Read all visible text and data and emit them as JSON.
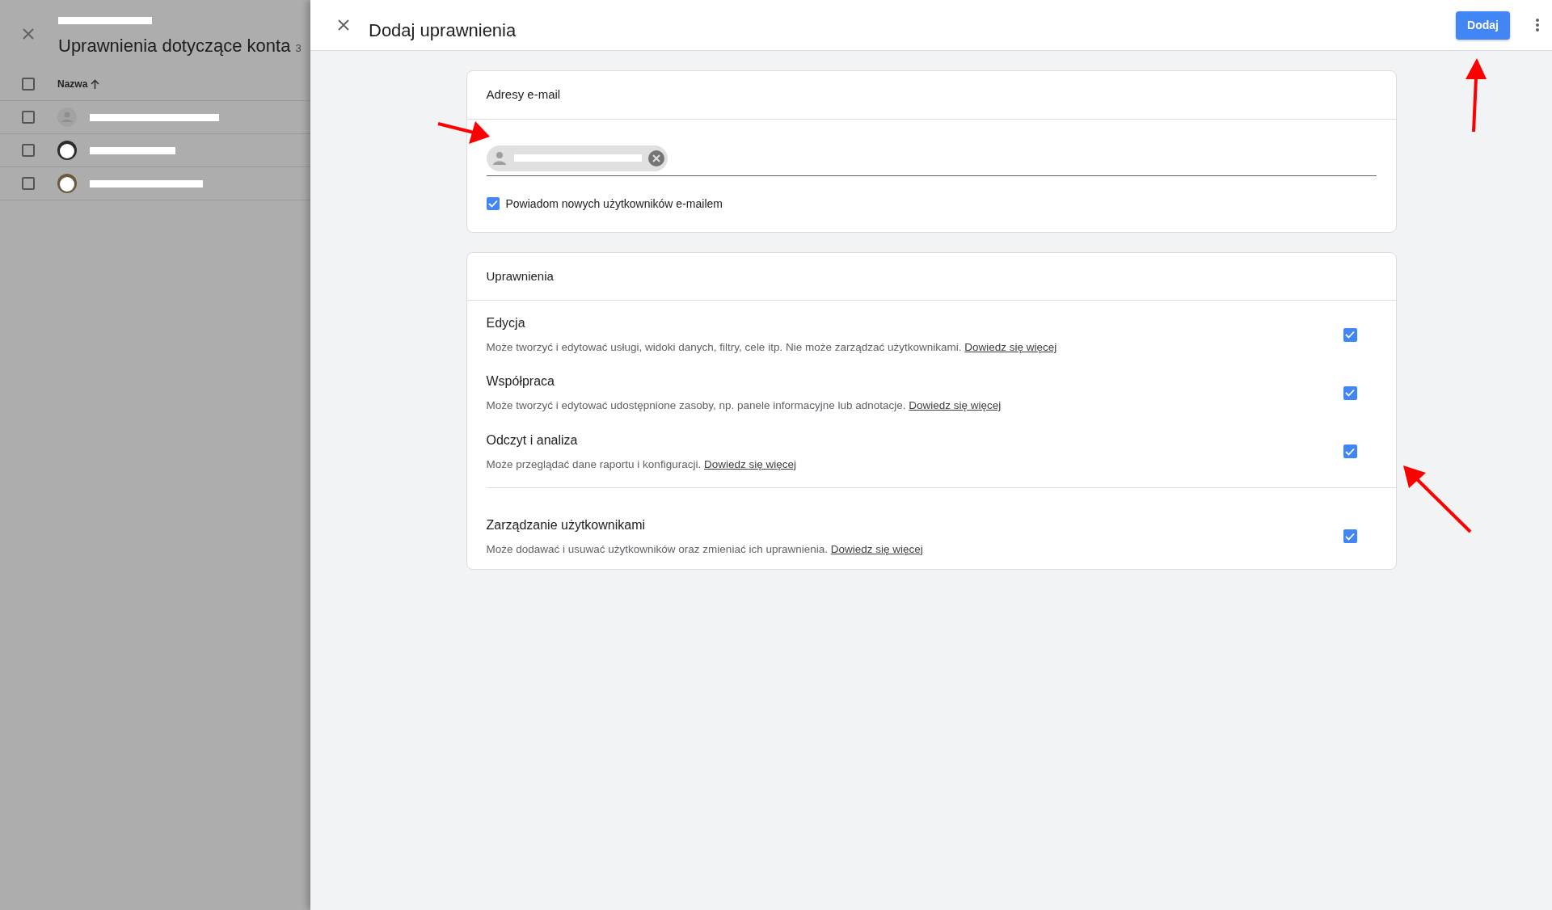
{
  "background_panel": {
    "title": "Uprawnienia dotyczące konta",
    "count_fragment": "3",
    "column_header": "Nazwa",
    "header_checked": false,
    "rows": [
      {
        "kind": "placeholder",
        "checked": false
      },
      {
        "kind": "dark",
        "checked": false
      },
      {
        "kind": "light",
        "checked": false
      }
    ]
  },
  "dialog": {
    "title": "Dodaj uprawnienia",
    "primary_button": "Dodaj"
  },
  "email_section": {
    "title": "Adresy e-mail",
    "chips": [
      {
        "kind": "redacted"
      }
    ],
    "notify": {
      "label": "Powiadom nowych użytkowników e-mailem",
      "checked": true
    }
  },
  "permissions": {
    "title": "Uprawnienia",
    "groups": [
      {
        "items": [
          {
            "name": "Edycja",
            "description": "Może tworzyć i edytować usługi, widoki danych, filtry, cele itp. Nie może zarządzać użytkownikami.",
            "link": "Dowiedz się więcej",
            "checked": true
          },
          {
            "name": "Współpraca",
            "description": "Może tworzyć i edytować udostępnione zasoby, np. panele informacyjne lub adnotacje.",
            "link": "Dowiedz się więcej",
            "checked": true
          },
          {
            "name": "Odczyt i analiza",
            "description": "Może przeglądać dane raportu i konfiguracji.",
            "link": "Dowiedz się więcej",
            "checked": true
          }
        ]
      },
      {
        "items": [
          {
            "name": "Zarządzanie użytkownikami",
            "description": "Może dodawać i usuwać użytkowników oraz zmieniać ich uprawnienia.",
            "link": "Dowiedz się więcej",
            "checked": true
          }
        ]
      }
    ]
  }
}
